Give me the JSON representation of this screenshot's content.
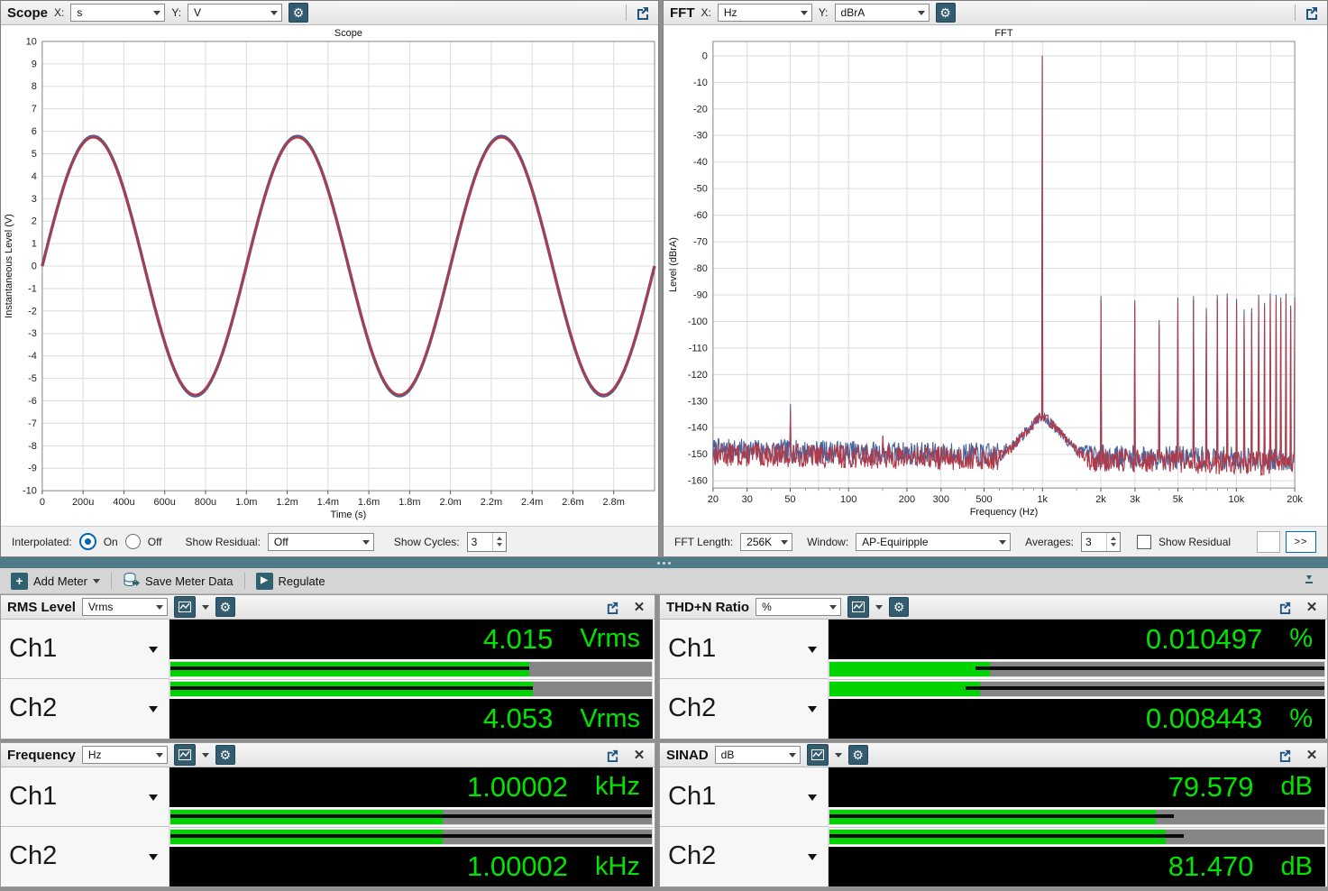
{
  "panels": {
    "scope": {
      "name": "Scope",
      "x_label": "X:",
      "x_value": "s",
      "y_label": "Y:",
      "y_value": "V",
      "controls": {
        "interpolated_label": "Interpolated:",
        "on_label": "On",
        "off_label": "Off",
        "show_residual_label": "Show Residual:",
        "show_residual_value": "Off",
        "show_cycles_label": "Show Cycles:",
        "show_cycles_value": "3"
      }
    },
    "fft": {
      "name": "FFT",
      "x_label": "X:",
      "x_value": "Hz",
      "y_label": "Y:",
      "y_value": "dBrA",
      "controls": {
        "fft_length_label": "FFT Length:",
        "fft_length_value": "256K",
        "window_label": "Window:",
        "window_value": "AP-Equiripple",
        "averages_label": "Averages:",
        "averages_value": "3",
        "show_residual_label": "Show Residual",
        "more_label": ">>"
      }
    }
  },
  "toolbar": {
    "add_meter": "Add Meter",
    "save_meter_data": "Save Meter Data",
    "regulate": "Regulate"
  },
  "meters": [
    {
      "title": "RMS Level",
      "unit_selector": "Vrms",
      "channels": [
        {
          "label": "Ch1",
          "value": "4.015",
          "unit": "Vrms",
          "bar_fill": 0.745,
          "stripe": [
            0,
            0.745
          ]
        },
        {
          "label": "Ch2",
          "value": "4.053",
          "unit": "Vrms",
          "bar_fill": 0.752,
          "stripe": [
            0,
            0.752
          ]
        }
      ]
    },
    {
      "title": "THD+N Ratio",
      "unit_selector": "%",
      "channels": [
        {
          "label": "Ch1",
          "value": "0.010497",
          "unit": "%",
          "bar_fill": 0.325,
          "stripe": [
            0.295,
            1
          ]
        },
        {
          "label": "Ch2",
          "value": "0.008443",
          "unit": "%",
          "bar_fill": 0.305,
          "stripe": [
            0.275,
            1
          ]
        }
      ]
    },
    {
      "title": "Frequency",
      "unit_selector": "Hz",
      "channels": [
        {
          "label": "Ch1",
          "value": "1.00002",
          "unit": "kHz",
          "bar_fill": 0.565,
          "stripe": [
            0,
            1
          ]
        },
        {
          "label": "Ch2",
          "value": "1.00002",
          "unit": "kHz",
          "bar_fill": 0.565,
          "stripe": [
            0,
            1
          ]
        }
      ]
    },
    {
      "title": "SINAD",
      "unit_selector": "dB",
      "channels": [
        {
          "label": "Ch1",
          "value": "79.579",
          "unit": "dB",
          "bar_fill": 0.66,
          "stripe": [
            0,
            0.695
          ]
        },
        {
          "label": "Ch2",
          "value": "81.470",
          "unit": "dB",
          "bar_fill": 0.68,
          "stripe": [
            0,
            0.715
          ]
        }
      ]
    }
  ],
  "chart_data": [
    {
      "type": "line",
      "title": "Scope",
      "xlabel": "Time (s)",
      "ylabel": "Instantaneous Level (V)",
      "xlim": [
        0,
        0.003
      ],
      "ylim": [
        -10,
        10
      ],
      "x_tick_values": [
        0,
        0.0002,
        0.0004,
        0.0006,
        0.0008,
        0.001,
        0.0012,
        0.0014,
        0.0016,
        0.0018,
        0.002,
        0.0022,
        0.0024,
        0.0026,
        0.0028
      ],
      "x_tick_labels": [
        "0",
        "200u",
        "400u",
        "600u",
        "800u",
        "1.0m",
        "1.2m",
        "1.4m",
        "1.6m",
        "1.8m",
        "2.0m",
        "2.2m",
        "2.4m",
        "2.6m",
        "2.8m"
      ],
      "y_tick_step": 1,
      "grid": true,
      "series": [
        {
          "name": "Ch1",
          "color": "#47639e",
          "waveform": "sine",
          "amplitude_v": 5.78,
          "frequency_hz": 1000,
          "phase_deg": 0,
          "cycles_shown": 3
        },
        {
          "name": "Ch2",
          "color": "#b03a48",
          "waveform": "sine",
          "amplitude_v": 5.73,
          "frequency_hz": 1000,
          "phase_deg": 0,
          "cycles_shown": 3
        }
      ]
    },
    {
      "type": "line",
      "title": "FFT",
      "xlabel": "Frequency (Hz)",
      "ylabel": "Level (dBrA)",
      "x_scale": "log",
      "xlim": [
        20,
        20000
      ],
      "ylim": [
        -160,
        0
      ],
      "x_tick_values": [
        20,
        30,
        50,
        100,
        200,
        300,
        500,
        1000,
        2000,
        3000,
        5000,
        10000,
        20000
      ],
      "x_tick_labels": [
        "20",
        "30",
        "50",
        "100",
        "200",
        "300",
        "500",
        "1k",
        "2k",
        "3k",
        "5k",
        "10k",
        "20k"
      ],
      "y_tick_step": 10,
      "grid_freqs": [
        20,
        30,
        50,
        70,
        100,
        200,
        300,
        500,
        700,
        1000,
        2000,
        3000,
        5000,
        7000,
        10000,
        15000,
        20000
      ],
      "noise_floor_db_ch1": -148.5,
      "noise_floor_db_ch2": -150,
      "fundamental": {
        "freq_hz": 1000,
        "db_ch1": 0,
        "db_ch2": 0
      },
      "mains_spike": {
        "freq_hz": 50,
        "db_ch1": -131,
        "db_ch2": -133.5
      },
      "minor_spurs": [
        {
          "freq_hz": 150,
          "db": -143
        }
      ],
      "harmonics_hz": [
        2000,
        3000,
        4000,
        5000,
        6000,
        7000,
        8000,
        9000,
        10000,
        11000,
        12000,
        13000,
        14000,
        15000,
        16000,
        17000,
        18000,
        19000,
        20000
      ],
      "harmonics_db_ch1": [
        -90.5,
        -92,
        -99.5,
        -91,
        -90.5,
        -95,
        -90,
        -89.5,
        -91.5,
        -95.5,
        -95,
        -90,
        -93,
        -89.5,
        -90,
        -91,
        -89.5,
        -94,
        -91
      ],
      "harmonics_db_ch2": [
        -92,
        -93.5,
        -101.5,
        -92.5,
        -92,
        -97,
        -91.5,
        -91,
        -93,
        -98,
        -96.5,
        -91.5,
        -94.5,
        -91,
        -91.5,
        -92.5,
        -91,
        -95.5,
        -92.5
      ],
      "series": [
        {
          "name": "Ch1",
          "color": "#47639e"
        },
        {
          "name": "Ch2",
          "color": "#b03a48"
        }
      ]
    }
  ],
  "icons": {
    "gear": "⚙",
    "plus": "+",
    "play": "▶",
    "close": "✕"
  }
}
